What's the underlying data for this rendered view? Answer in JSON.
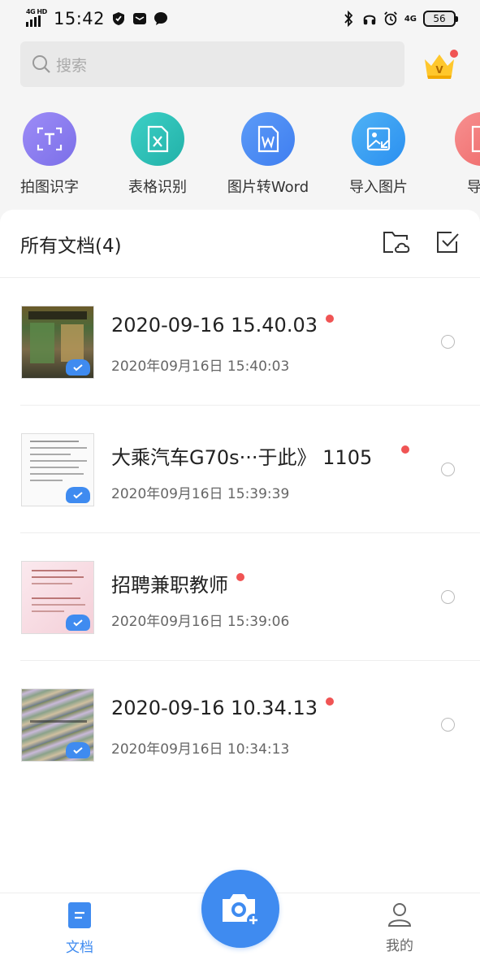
{
  "status_bar": {
    "network_label": "4G HD",
    "time": "15:42",
    "right_network": "4G",
    "battery": "56"
  },
  "search": {
    "placeholder": "搜索"
  },
  "tools": [
    {
      "label": "拍图识字",
      "icon": "scan-text-icon",
      "color": "#8b7bf0"
    },
    {
      "label": "表格识别",
      "icon": "excel-icon",
      "color": "#2fc1b8"
    },
    {
      "label": "图片转Word",
      "icon": "word-icon",
      "color": "#4d8cf5"
    },
    {
      "label": "导入图片",
      "icon": "import-image-icon",
      "color": "#3aa0f0"
    },
    {
      "label": "导入",
      "icon": "import-file-icon",
      "color": "#f07878"
    }
  ],
  "documents": {
    "title": "所有文档(4)",
    "items": [
      {
        "title": "2020-09-16 15.40.03",
        "date": "2020年09月16日 15:40:03",
        "thumb": "photo-shop"
      },
      {
        "title": "大乘汽车G70s···于此》 1105",
        "date": "2020年09月16日 15:39:39",
        "thumb": "doc-text"
      },
      {
        "title": "招聘兼职教师",
        "date": "2020年09月16日 15:39:06",
        "thumb": "doc-pink"
      },
      {
        "title": "2020-09-16 10.34.13",
        "date": "2020年09月16日 10:34:13",
        "thumb": "photo-moire"
      }
    ]
  },
  "bottom_nav": {
    "docs_label": "文档",
    "mine_label": "我的",
    "active_color": "#3f8bf0"
  }
}
